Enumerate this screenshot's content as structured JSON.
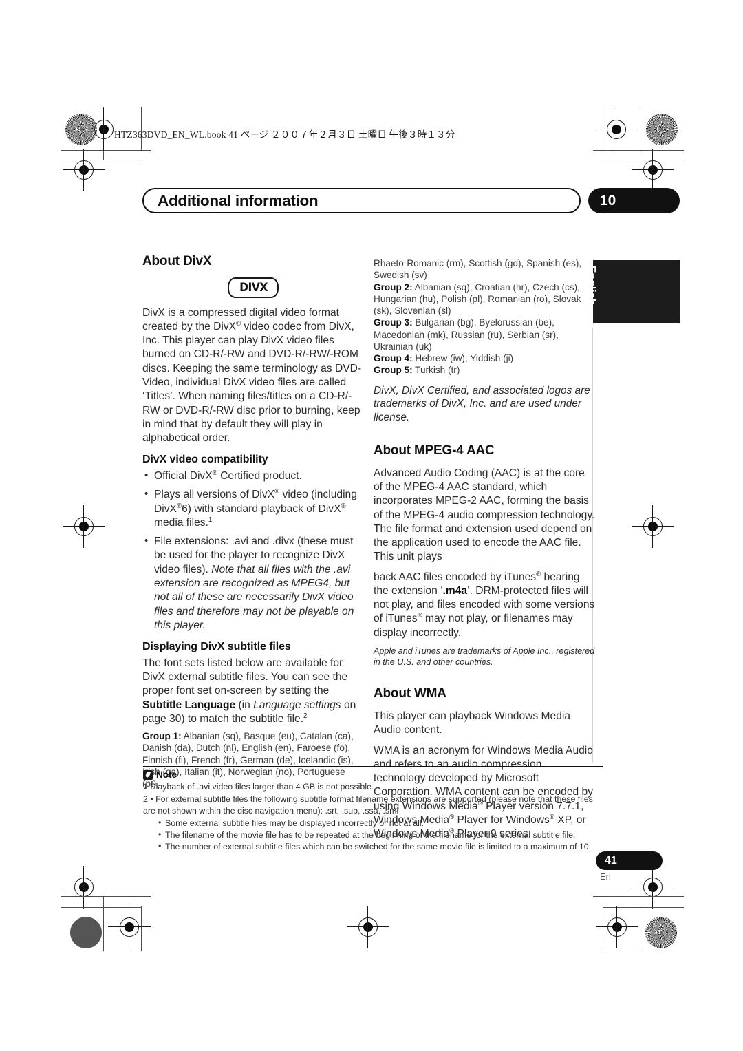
{
  "file_slug": "HTZ363DVD_EN_WL.book   41 ページ   ２００７年２月３日   土曜日   午後３時１３分",
  "chapter": {
    "title": "Additional information",
    "number": "10"
  },
  "language_tab": "English",
  "page_footer": {
    "number": "41",
    "lang": "En"
  },
  "left_column": {
    "divx_heading": "About DivX",
    "divx_logo_text": "DIVX",
    "divx_intro": "DivX is a compressed digital video format created by the DivX® video codec from DivX, Inc. This player can play DivX video files burned on CD-R/-RW and DVD-R/-RW/-ROM discs. Keeping the same terminology as DVD-Video, individual DivX video files are called ‘Titles’. When naming files/titles on a CD-R/-RW or DVD-R/-RW disc prior to burning, keep in mind that by default they will play in alphabetical order.",
    "compat_heading": "DivX video compatibility",
    "compat_bullets": [
      "Official DivX® Certified product.",
      "Plays all versions of DivX® video (including DivX®6) with standard playback of DivX® media files.1",
      "File extensions: .avi and .divx (these must be used for the player to recognize DivX video files). Note that all files with the .avi extension are recognized as MPEG4, but not all of these are necessarily DivX video files and therefore may not be playable on this player."
    ],
    "subtitle_heading": "Displaying DivX subtitle files",
    "subtitle_intro": "The font sets listed below are available for DivX external subtitle files. You can see the proper font set on-screen by setting the Subtitle Language (in Language settings on page 30) to match the subtitle file.2",
    "group1_label": "Group 1:",
    "group1_text": "Albanian (sq), Basque (eu), Catalan (ca), Danish (da), Dutch (nl), English (en), Faroese (fo), Finnish (fi), French (fr), German (de), Icelandic (is), Irish (ga), Italian (it), Norwegian (no), Portuguese (pt),"
  },
  "right_column": {
    "group1_cont": "Rhaeto-Romanic (rm), Scottish (gd), Spanish (es), Swedish (sv)",
    "group2_label": "Group 2:",
    "group2_text": "Albanian (sq), Croatian (hr), Czech (cs), Hungarian (hu), Polish (pl), Romanian (ro), Slovak (sk), Slovenian (sl)",
    "group3_label": "Group 3:",
    "group3_text": "Bulgarian (bg), Byelorussian (be), Macedonian (mk), Russian (ru), Serbian (sr), Ukrainian (uk)",
    "group4_label": "Group 4:",
    "group4_text": "Hebrew (iw), Yiddish (ji)",
    "group5_label": "Group 5:",
    "group5_text": "Turkish (tr)",
    "divx_trademark": "DivX, DivX Certified, and associated logos are trademarks of DivX, Inc. and are used under license.",
    "aac_heading": "About MPEG-4 AAC",
    "aac_body_1": "Advanced Audio Coding (AAC) is at the core of the MPEG-4 AAC standard, which incorporates MPEG-2 AAC, forming the basis of the MPEG-4 audio compression technology. The file format and extension used depend on the application used to encode the AAC file. This unit plays",
    "aac_body_2": "back AAC files encoded by iTunes® bearing the extension ‘.m4a’. DRM-protected files will not play, and files encoded with some versions of iTunes® may not play, or filenames may display incorrectly.",
    "apple_trademark": "Apple and iTunes are trademarks of Apple Inc., registered in the U.S. and other countries.",
    "wma_heading": "About WMA",
    "wma_body_1": "This player can playback Windows Media Audio content.",
    "wma_body_2": "WMA is an acronym for Windows Media Audio and refers to an audio compression technology developed by Microsoft Corporation. WMA content can be encoded by using Windows Media® Player version 7.7.1, Windows Media® Player for Windows® XP, or Windows Media® Player 9 series."
  },
  "note": {
    "title": "Note",
    "item_1": "1 Playback of .avi video files larger than 4 GB is not possible.",
    "item_2": "2 • For external subtitle files the following subtitle format filename extensions are supported (please note that these files are not shown within the disc navigation menu): .srt, .sub, .ssa, .smi",
    "sub_bullets": [
      "Some external subtitle files may be displayed incorrectly or not at all.",
      "The filename of the movie file has to be repeated at the beginning of the filename for the external subtitle file.",
      "The number of external subtitle files which can be switched for the same movie file is limited to a maximum of 10."
    ]
  }
}
